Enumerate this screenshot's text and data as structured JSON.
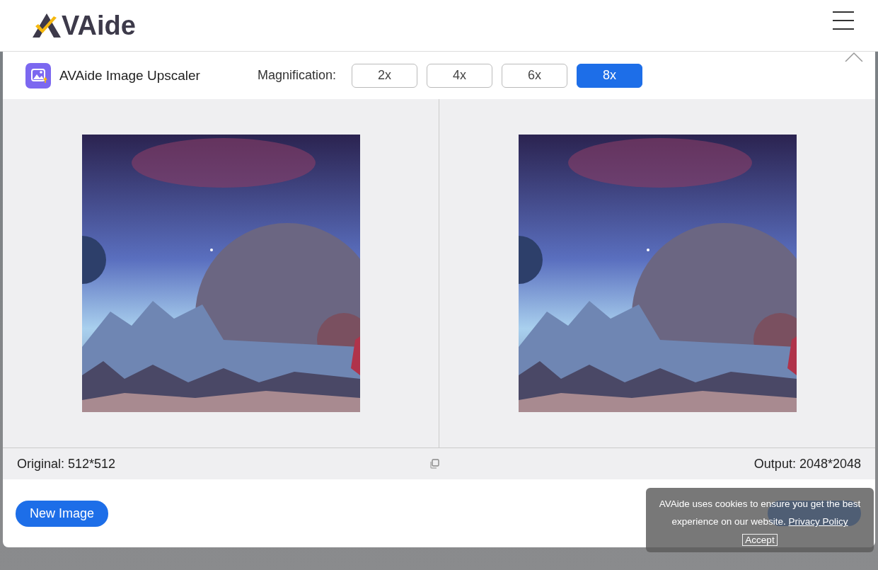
{
  "header": {
    "logo_text": "VAide"
  },
  "dialog": {
    "title": "AVAide Image Upscaler",
    "magnification_label": "Magnification:",
    "magnifications": [
      {
        "label": "2x",
        "selected": false
      },
      {
        "label": "4x",
        "selected": false
      },
      {
        "label": "6x",
        "selected": false
      },
      {
        "label": "8x",
        "selected": true
      }
    ],
    "original_info": "Original: 512*512",
    "output_info": "Output: 2048*2048",
    "new_image_button": "New Image"
  },
  "cookie_banner": {
    "text": "AVAide uses cookies to ensure you get the best experience on our website.",
    "link": "Privacy Policy",
    "accept": "Accept"
  }
}
